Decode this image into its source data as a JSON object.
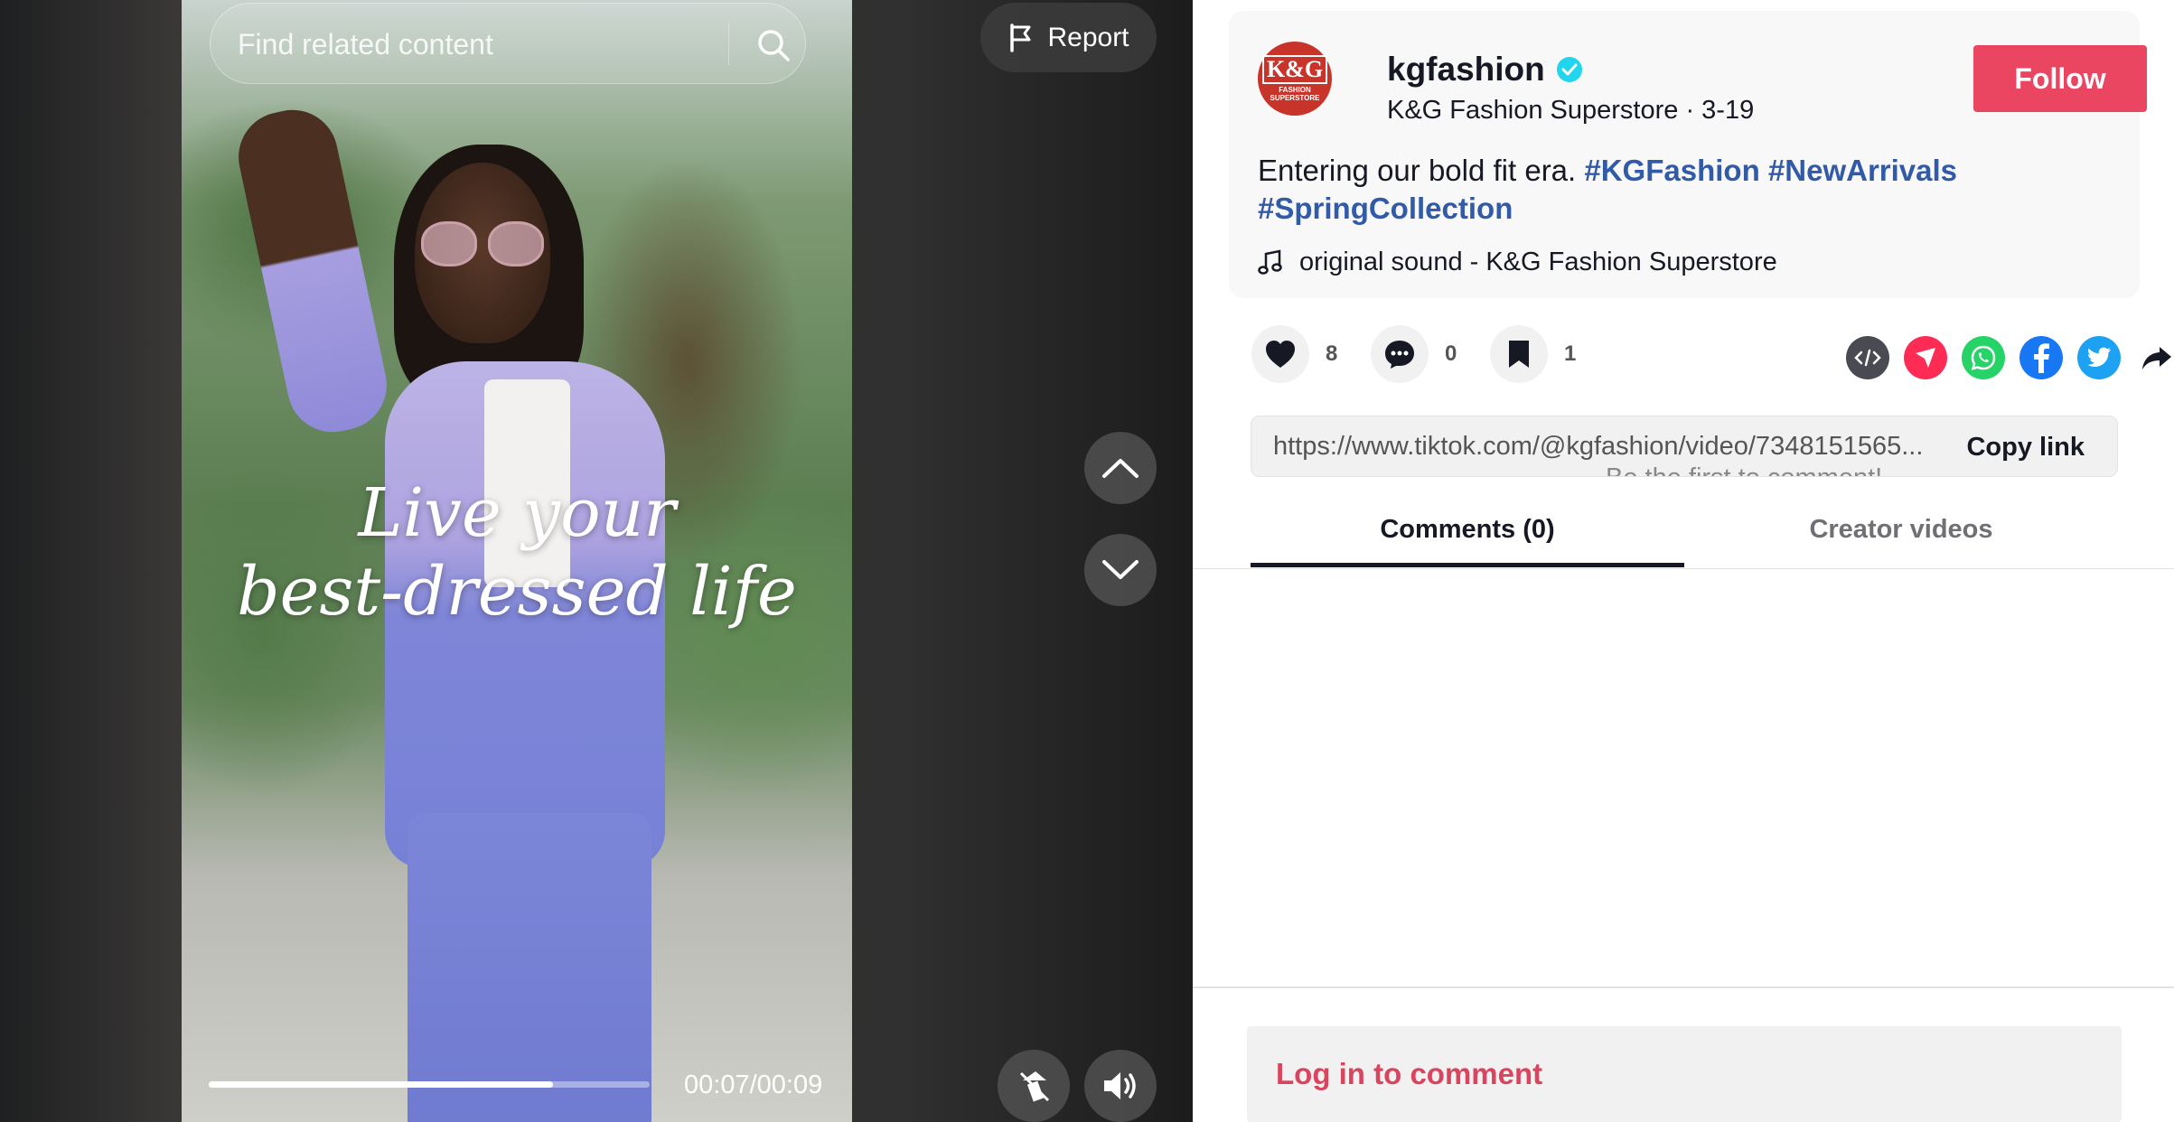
{
  "video": {
    "search_placeholder": "Find related content",
    "overlay_line1": "Live your",
    "overlay_line2": "best-dressed life",
    "time": "00:07/00:09",
    "progress": 0.78,
    "report_label": "Report"
  },
  "author": {
    "avatar_text": "K&G",
    "avatar_subtext": "FASHION SUPERSTORE",
    "username": "kgfashion",
    "display_line": "K&G Fashion Superstore · 3-19",
    "follow_label": "Follow",
    "verified_color": "#20d5ec"
  },
  "post": {
    "caption_text": "Entering our bold fit era. ",
    "hashtags": [
      "#KGFashion",
      "#NewArrivals",
      "#SpringCollection"
    ],
    "sound": "original sound - K&G Fashion Superstore"
  },
  "actions": {
    "likes": "8",
    "comments": "0",
    "saves": "1",
    "share_icons": [
      "embed-icon",
      "send-icon",
      "whatsapp-icon",
      "facebook-icon",
      "twitter-icon",
      "share-arrow-icon"
    ]
  },
  "link": {
    "url": "https://www.tiktok.com/@kgfashion/video/7348151565...",
    "copy_label": "Copy link",
    "ghost_text": "Be the first to comment!"
  },
  "tabs": {
    "comments": "Comments (0)",
    "creator_videos": "Creator videos"
  },
  "login_label": "Log in to comment",
  "colors": {
    "accent": "#ea4561",
    "hashtag": "#315aa8"
  }
}
